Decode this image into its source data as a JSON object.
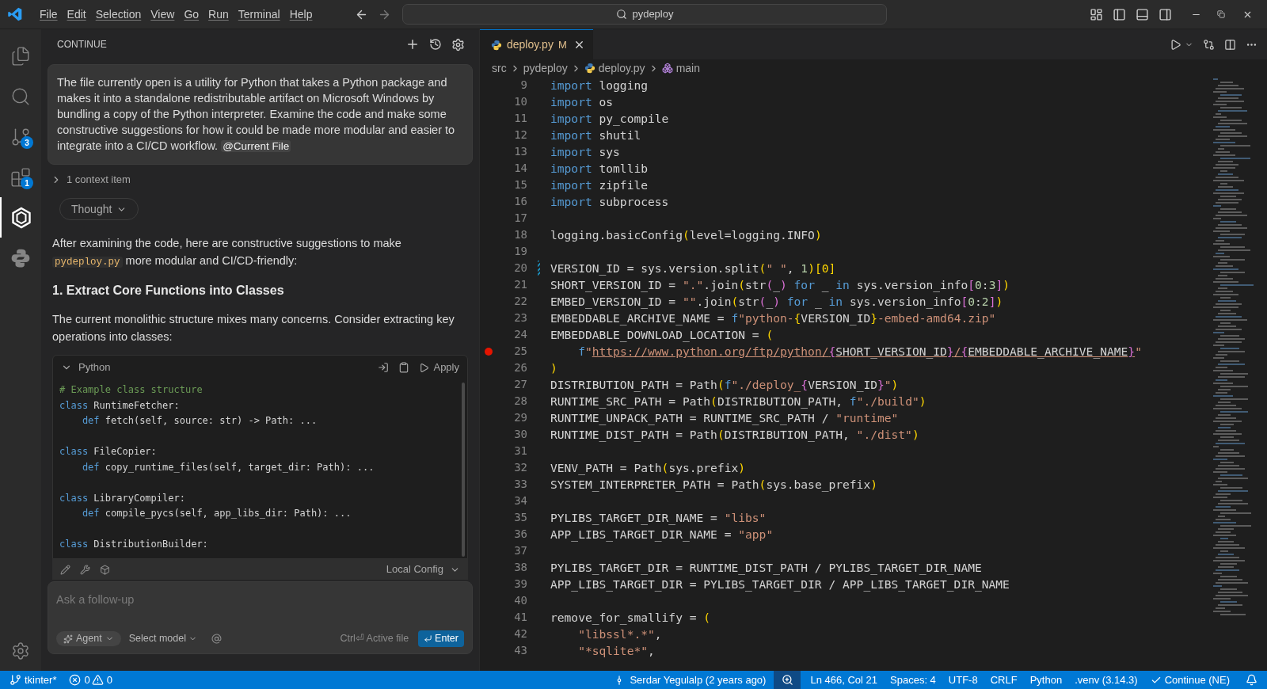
{
  "menu": [
    "File",
    "Edit",
    "Selection",
    "View",
    "Go",
    "Run",
    "Terminal",
    "Help"
  ],
  "search": {
    "value": "pydeploy"
  },
  "activity": [
    {
      "selected": false
    },
    {
      "selected": false
    },
    {
      "selected": false,
      "badge": "3"
    },
    {
      "selected": false,
      "badge": "1"
    },
    {
      "selected": true
    },
    {
      "selected": false
    }
  ],
  "chat": {
    "title": "CONTINUE",
    "message": "The file currently open is a utility for Python that takes a Python package and makes it into a standalone redistributable artifact on Microsoft Windows by bundling a copy of the Python interpreter. Examine the code and make some constructive suggestions for how it could be made more modular and easier to integrate into a CI/CD workflow.",
    "mention": "@Current File",
    "context": {
      "label": "1 context item",
      "expanded": false
    },
    "thought": "Thought",
    "intro_before": "After examining the code, here are constructive suggestions to make",
    "intro_code": "pydeploy.py",
    "intro_after": "more modular and CI/CD-friendly:",
    "heading": "1. Extract Core Functions into Classes",
    "paragraph": "The current monolithic structure mixes many concerns. Consider extracting key operations into classes:",
    "code_block": {
      "language": "Python",
      "expanded": true,
      "apply": "Apply",
      "blocks": [
        [
          [
            {
              "kind": "com",
              "text": "# Example class structure"
            }
          ],
          [
            {
              "kind": "kw",
              "text": "class"
            },
            {
              "kind": "p",
              "text": " RuntimeFetcher:"
            }
          ],
          [
            {
              "kind": "kw",
              "text": "    def"
            },
            {
              "kind": "p",
              "text": " fetch(self, source: str) -> Path: ..."
            }
          ]
        ],
        [
          [
            {
              "kind": "kw",
              "text": "class"
            },
            {
              "kind": "p",
              "text": " FileCopier:"
            }
          ],
          [
            {
              "kind": "kw",
              "text": "    def"
            },
            {
              "kind": "p",
              "text": " copy_runtime_files(self, target_dir: Path): ..."
            }
          ]
        ],
        [
          [
            {
              "kind": "kw",
              "text": "class"
            },
            {
              "kind": "p",
              "text": " LibraryCompiler:"
            }
          ],
          [
            {
              "kind": "kw",
              "text": "    def"
            },
            {
              "kind": "p",
              "text": " compile_pycs(self, app_libs_dir: Path): ..."
            }
          ]
        ],
        [
          [
            {
              "kind": "kw",
              "text": "class"
            },
            {
              "kind": "p",
              "text": " DistributionBuilder:"
            }
          ]
        ]
      ]
    },
    "config": "Local Config",
    "input": {
      "placeholder": "Ask a follow-up"
    },
    "mode": "Agent",
    "model": "Select model",
    "hint": "Ctrl⏎ Active file",
    "send": "Enter"
  },
  "editor": {
    "tab": {
      "name": "deploy.py",
      "status": "M",
      "selected": true
    },
    "breadcrumbs": [
      "src",
      "pydeploy",
      "deploy.py",
      "main"
    ],
    "lines": [
      {
        "number": "9",
        "changed": false,
        "breakpoint": false,
        "tokens": [
          {
            "kind": "kw",
            "text": "import"
          },
          {
            "kind": "p",
            "text": " logging"
          }
        ]
      },
      {
        "number": "10",
        "changed": false,
        "breakpoint": false,
        "tokens": [
          {
            "kind": "kw",
            "text": "import"
          },
          {
            "kind": "p",
            "text": " os"
          }
        ]
      },
      {
        "number": "11",
        "changed": false,
        "breakpoint": false,
        "tokens": [
          {
            "kind": "kw",
            "text": "import"
          },
          {
            "kind": "p",
            "text": " py_compile"
          }
        ]
      },
      {
        "number": "12",
        "changed": false,
        "breakpoint": false,
        "tokens": [
          {
            "kind": "kw",
            "text": "import"
          },
          {
            "kind": "p",
            "text": " shutil"
          }
        ]
      },
      {
        "number": "13",
        "changed": false,
        "breakpoint": false,
        "tokens": [
          {
            "kind": "kw",
            "text": "import"
          },
          {
            "kind": "p",
            "text": " sys"
          }
        ]
      },
      {
        "number": "14",
        "changed": false,
        "breakpoint": false,
        "tokens": [
          {
            "kind": "kw",
            "text": "import"
          },
          {
            "kind": "p",
            "text": " tomllib"
          }
        ]
      },
      {
        "number": "15",
        "changed": false,
        "breakpoint": false,
        "tokens": [
          {
            "kind": "kw",
            "text": "import"
          },
          {
            "kind": "p",
            "text": " zipfile"
          }
        ]
      },
      {
        "number": "16",
        "changed": false,
        "breakpoint": false,
        "tokens": [
          {
            "kind": "kw",
            "text": "import"
          },
          {
            "kind": "p",
            "text": " subprocess"
          }
        ]
      },
      {
        "number": "17",
        "changed": false,
        "breakpoint": false
      },
      {
        "number": "18",
        "changed": false,
        "breakpoint": false,
        "tokens": [
          {
            "kind": "p",
            "text": "logging.basicConfig"
          },
          {
            "kind": "b1",
            "text": "("
          },
          {
            "kind": "p",
            "text": "level=logging.INFO"
          },
          {
            "kind": "b1",
            "text": ")"
          }
        ]
      },
      {
        "number": "19",
        "changed": false,
        "breakpoint": false
      },
      {
        "number": "20",
        "changed": true,
        "breakpoint": false,
        "tokens": [
          {
            "kind": "p",
            "text": "VERSION_ID = sys.version.split"
          },
          {
            "kind": "b1",
            "text": "("
          },
          {
            "kind": "s",
            "text": "\" \""
          },
          {
            "kind": "p",
            "text": ", "
          },
          {
            "kind": "n",
            "text": "1"
          },
          {
            "kind": "b1",
            "text": ")[0]"
          }
        ]
      },
      {
        "number": "21",
        "changed": false,
        "breakpoint": false,
        "tokens": [
          {
            "kind": "p",
            "text": "SHORT_VERSION_ID = "
          },
          {
            "kind": "s",
            "text": "\".\""
          },
          {
            "kind": "p",
            "text": ".join"
          },
          {
            "kind": "b1",
            "text": "("
          },
          {
            "kind": "p",
            "text": "str"
          },
          {
            "kind": "b2",
            "text": "("
          },
          {
            "kind": "p",
            "text": "_"
          },
          {
            "kind": "b2",
            "text": ")"
          },
          {
            "kind": "kw",
            "text": " for"
          },
          {
            "kind": "p",
            "text": " _ "
          },
          {
            "kind": "kw",
            "text": "in"
          },
          {
            "kind": "p",
            "text": " sys.version_info"
          },
          {
            "kind": "b2",
            "text": "["
          },
          {
            "kind": "n",
            "text": "0"
          },
          {
            "kind": "p",
            "text": ":"
          },
          {
            "kind": "n",
            "text": "3"
          },
          {
            "kind": "b2",
            "text": "]"
          },
          {
            "kind": "b1",
            "text": ")"
          }
        ]
      },
      {
        "number": "22",
        "changed": false,
        "breakpoint": false,
        "tokens": [
          {
            "kind": "p",
            "text": "EMBED_VERSION_ID = "
          },
          {
            "kind": "s",
            "text": "\"\""
          },
          {
            "kind": "p",
            "text": ".join"
          },
          {
            "kind": "b1",
            "text": "("
          },
          {
            "kind": "p",
            "text": "str"
          },
          {
            "kind": "b2",
            "text": "("
          },
          {
            "kind": "p",
            "text": "_"
          },
          {
            "kind": "b2",
            "text": ")"
          },
          {
            "kind": "kw",
            "text": " for"
          },
          {
            "kind": "p",
            "text": " _ "
          },
          {
            "kind": "kw",
            "text": "in"
          },
          {
            "kind": "p",
            "text": " sys.version_info"
          },
          {
            "kind": "b2",
            "text": "["
          },
          {
            "kind": "n",
            "text": "0"
          },
          {
            "kind": "p",
            "text": ":"
          },
          {
            "kind": "n",
            "text": "2"
          },
          {
            "kind": "b2",
            "text": "]"
          },
          {
            "kind": "b1",
            "text": ")"
          }
        ]
      },
      {
        "number": "23",
        "changed": false,
        "breakpoint": false,
        "tokens": [
          {
            "kind": "p",
            "text": "EMBEDDABLE_ARCHIVE_NAME = "
          },
          {
            "kind": "kw",
            "text": "f"
          },
          {
            "kind": "s",
            "text": "\"python-"
          },
          {
            "kind": "b1",
            "text": "{"
          },
          {
            "kind": "p",
            "text": "VERSION_ID"
          },
          {
            "kind": "b1",
            "text": "}"
          },
          {
            "kind": "s",
            "text": "-embed-amd64.zip\""
          }
        ]
      },
      {
        "number": "24",
        "changed": false,
        "breakpoint": false,
        "tokens": [
          {
            "kind": "p",
            "text": "EMBEDDABLE_DOWNLOAD_LOCATION = "
          },
          {
            "kind": "b1",
            "text": "("
          }
        ]
      },
      {
        "number": "25",
        "changed": false,
        "breakpoint": true,
        "tokens": [
          {
            "kind": "kw",
            "text": "    f"
          },
          {
            "kind": "s",
            "text": "\""
          },
          {
            "kind": "su",
            "text": "https://www.python.org/ftp/python/"
          },
          {
            "kind": "b2u",
            "text": "{"
          },
          {
            "kind": "pu",
            "text": "SHORT_VERSION_ID"
          },
          {
            "kind": "b2u",
            "text": "}"
          },
          {
            "kind": "su",
            "text": "/"
          },
          {
            "kind": "b2u",
            "text": "{"
          },
          {
            "kind": "pu",
            "text": "EMBEDDABLE_ARCHIVE_NAME"
          },
          {
            "kind": "b2u",
            "text": "}"
          },
          {
            "kind": "s",
            "text": "\""
          }
        ]
      },
      {
        "number": "26",
        "changed": false,
        "breakpoint": false,
        "tokens": [
          {
            "kind": "b1",
            "text": ")"
          }
        ]
      },
      {
        "number": "27",
        "changed": false,
        "breakpoint": false,
        "tokens": [
          {
            "kind": "p",
            "text": "DISTRIBUTION_PATH = Path"
          },
          {
            "kind": "b1",
            "text": "("
          },
          {
            "kind": "kw",
            "text": "f"
          },
          {
            "kind": "s",
            "text": "\"./deploy_"
          },
          {
            "kind": "b2",
            "text": "{"
          },
          {
            "kind": "p",
            "text": "VERSION_ID"
          },
          {
            "kind": "b2",
            "text": "}"
          },
          {
            "kind": "s",
            "text": "\""
          },
          {
            "kind": "b1",
            "text": ")"
          }
        ]
      },
      {
        "number": "28",
        "changed": false,
        "breakpoint": false,
        "tokens": [
          {
            "kind": "p",
            "text": "RUNTIME_SRC_PATH = Path"
          },
          {
            "kind": "b1",
            "text": "("
          },
          {
            "kind": "p",
            "text": "DISTRIBUTION_PATH, "
          },
          {
            "kind": "kw",
            "text": "f"
          },
          {
            "kind": "s",
            "text": "\"./build\""
          },
          {
            "kind": "b1",
            "text": ")"
          }
        ]
      },
      {
        "number": "29",
        "changed": false,
        "breakpoint": false,
        "tokens": [
          {
            "kind": "p",
            "text": "RUNTIME_UNPACK_PATH = RUNTIME_SRC_PATH / "
          },
          {
            "kind": "s",
            "text": "\"runtime\""
          }
        ]
      },
      {
        "number": "30",
        "changed": false,
        "breakpoint": false,
        "tokens": [
          {
            "kind": "p",
            "text": "RUNTIME_DIST_PATH = Path"
          },
          {
            "kind": "b1",
            "text": "("
          },
          {
            "kind": "p",
            "text": "DISTRIBUTION_PATH, "
          },
          {
            "kind": "s",
            "text": "\"./dist\""
          },
          {
            "kind": "b1",
            "text": ")"
          }
        ]
      },
      {
        "number": "31",
        "changed": false,
        "breakpoint": false
      },
      {
        "number": "32",
        "changed": false,
        "breakpoint": false,
        "tokens": [
          {
            "kind": "p",
            "text": "VENV_PATH = Path"
          },
          {
            "kind": "b1",
            "text": "("
          },
          {
            "kind": "p",
            "text": "sys.prefix"
          },
          {
            "kind": "b1",
            "text": ")"
          }
        ]
      },
      {
        "number": "33",
        "changed": false,
        "breakpoint": false,
        "tokens": [
          {
            "kind": "p",
            "text": "SYSTEM_INTERPRETER_PATH = Path"
          },
          {
            "kind": "b1",
            "text": "("
          },
          {
            "kind": "p",
            "text": "sys.base_prefix"
          },
          {
            "kind": "b1",
            "text": ")"
          }
        ]
      },
      {
        "number": "34",
        "changed": false,
        "breakpoint": false
      },
      {
        "number": "35",
        "changed": false,
        "breakpoint": false,
        "tokens": [
          {
            "kind": "p",
            "text": "PYLIBS_TARGET_DIR_NAME = "
          },
          {
            "kind": "s",
            "text": "\"libs\""
          }
        ]
      },
      {
        "number": "36",
        "changed": false,
        "breakpoint": false,
        "tokens": [
          {
            "kind": "p",
            "text": "APP_LIBS_TARGET_DIR_NAME = "
          },
          {
            "kind": "s",
            "text": "\"app\""
          }
        ]
      },
      {
        "number": "37",
        "changed": false,
        "breakpoint": false
      },
      {
        "number": "38",
        "changed": false,
        "breakpoint": false,
        "tokens": [
          {
            "kind": "p",
            "text": "PYLIBS_TARGET_DIR = RUNTIME_DIST_PATH / PYLIBS_TARGET_DIR_NAME"
          }
        ]
      },
      {
        "number": "39",
        "changed": false,
        "breakpoint": false,
        "tokens": [
          {
            "kind": "p",
            "text": "APP_LIBS_TARGET_DIR = PYLIBS_TARGET_DIR / APP_LIBS_TARGET_DIR_NAME"
          }
        ]
      },
      {
        "number": "40",
        "changed": false,
        "breakpoint": false
      },
      {
        "number": "41",
        "changed": false,
        "breakpoint": false,
        "tokens": [
          {
            "kind": "p",
            "text": "remove_for_smallify = "
          },
          {
            "kind": "b1",
            "text": "("
          }
        ]
      },
      {
        "number": "42",
        "changed": false,
        "breakpoint": false,
        "tokens": [
          {
            "kind": "s",
            "text": "    \"libssl*.*\""
          },
          {
            "kind": "p",
            "text": ","
          }
        ]
      },
      {
        "number": "43",
        "changed": false,
        "breakpoint": false,
        "tokens": [
          {
            "kind": "s",
            "text": "    \"*sqlite*\""
          },
          {
            "kind": "p",
            "text": ","
          }
        ]
      }
    ]
  },
  "status_bar": {
    "branch": "tkinter*",
    "errors": "0",
    "warnings": "0",
    "blame": "Serdar Yegulalp (2 years ago)",
    "position": "Ln 466, Col 21",
    "spaces": "Spaces: 4",
    "encoding": "UTF-8",
    "eol": "CRLF",
    "language": "Python",
    "interpreter": ".venv (3.14.3)",
    "continue": "Continue (NE)"
  }
}
